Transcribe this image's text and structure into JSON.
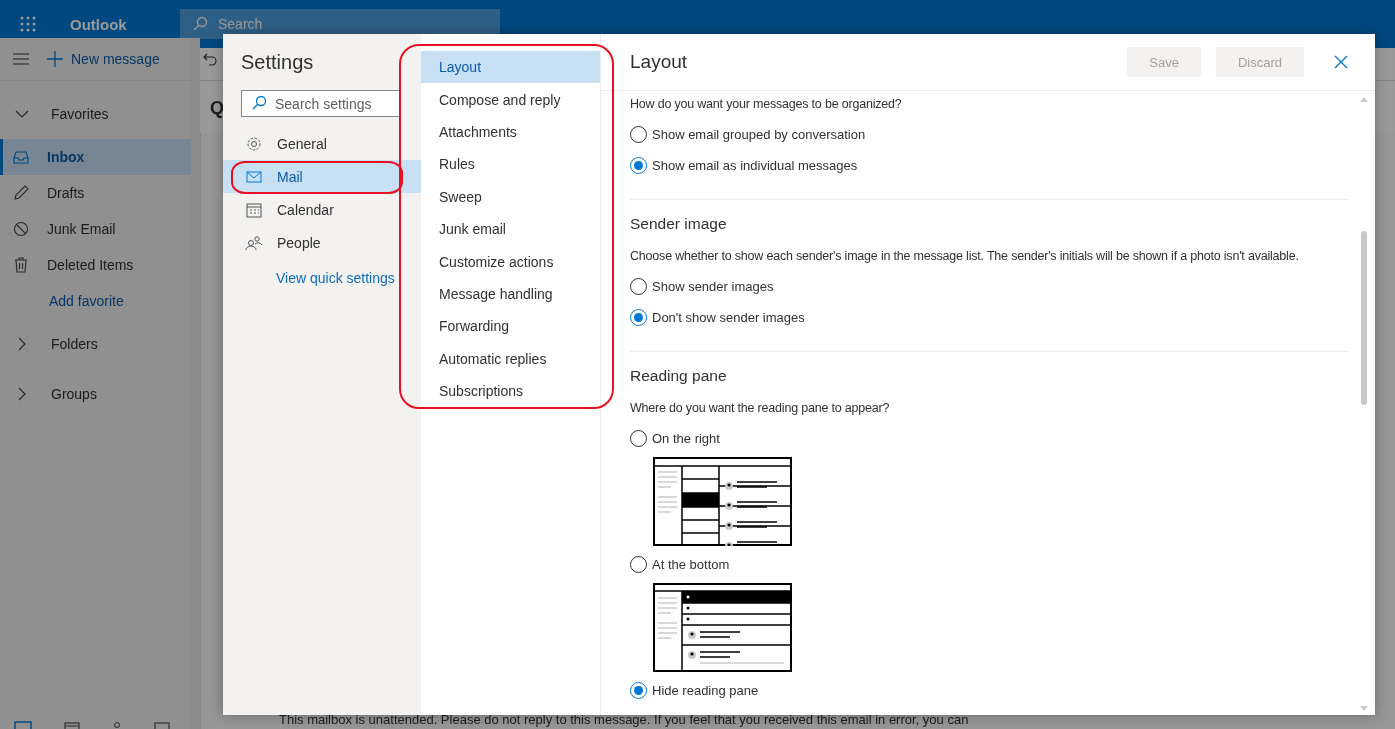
{
  "app": {
    "name": "Outlook",
    "search_placeholder": "Search",
    "new_message": "New message",
    "nav": [
      {
        "label": "Favorites",
        "kind": "group",
        "expanded": true
      },
      {
        "label": "Inbox",
        "kind": "folder",
        "selected": true
      },
      {
        "label": "Drafts",
        "kind": "folder",
        "selected": false
      },
      {
        "label": "Junk Email",
        "kind": "folder",
        "selected": false
      },
      {
        "label": "Deleted Items",
        "kind": "folder",
        "selected": false
      },
      {
        "label": "Add favorite",
        "kind": "link"
      },
      {
        "label": "Folders",
        "kind": "group",
        "expanded": false
      },
      {
        "label": "Groups",
        "kind": "group",
        "expanded": false
      }
    ],
    "list_heading": "Q",
    "message_text": "This mailbox is unattended. Please do not reply to this message. If you feel that you received this email in error, you can"
  },
  "settings": {
    "title": "Settings",
    "search_placeholder": "Search settings",
    "categories": [
      {
        "label": "General",
        "selected": false,
        "circled": false
      },
      {
        "label": "Mail",
        "selected": true,
        "circled": true
      },
      {
        "label": "Calendar",
        "selected": false,
        "circled": false
      },
      {
        "label": "People",
        "selected": false,
        "circled": false
      }
    ],
    "quick_link": "View quick settings",
    "subcategories_circled": true,
    "subcategories": [
      {
        "label": "Layout",
        "selected": true
      },
      {
        "label": "Compose and reply",
        "selected": false
      },
      {
        "label": "Attachments",
        "selected": false
      },
      {
        "label": "Rules",
        "selected": false
      },
      {
        "label": "Sweep",
        "selected": false
      },
      {
        "label": "Junk email",
        "selected": false
      },
      {
        "label": "Customize actions",
        "selected": false
      },
      {
        "label": "Message handling",
        "selected": false
      },
      {
        "label": "Forwarding",
        "selected": false
      },
      {
        "label": "Automatic replies",
        "selected": false
      },
      {
        "label": "Subscriptions",
        "selected": false
      }
    ],
    "page_title": "Layout",
    "buttons": [
      {
        "label": "Save",
        "disabled": true
      },
      {
        "label": "Discard",
        "disabled": true
      }
    ],
    "sections": [
      {
        "question": "How do you want your messages to be organized?",
        "options": [
          {
            "label": "Show email grouped by conversation",
            "selected": false
          },
          {
            "label": "Show email as individual messages",
            "selected": true
          }
        ]
      },
      {
        "heading": "Sender image",
        "question": "Choose whether to show each sender's image in the message list. The sender's initials will be shown if a photo isn't available.",
        "options": [
          {
            "label": "Show sender images",
            "selected": false
          },
          {
            "label": "Don't show sender images",
            "selected": true
          }
        ]
      },
      {
        "heading": "Reading pane",
        "question": "Where do you want the reading pane to appear?",
        "options": [
          {
            "label": "On the right",
            "selected": false,
            "kind": "right_preview"
          },
          {
            "label": "At the bottom",
            "selected": false,
            "kind": "bottom_preview"
          },
          {
            "label": "Hide reading pane",
            "selected": true,
            "kind": "plain"
          }
        ]
      }
    ]
  }
}
